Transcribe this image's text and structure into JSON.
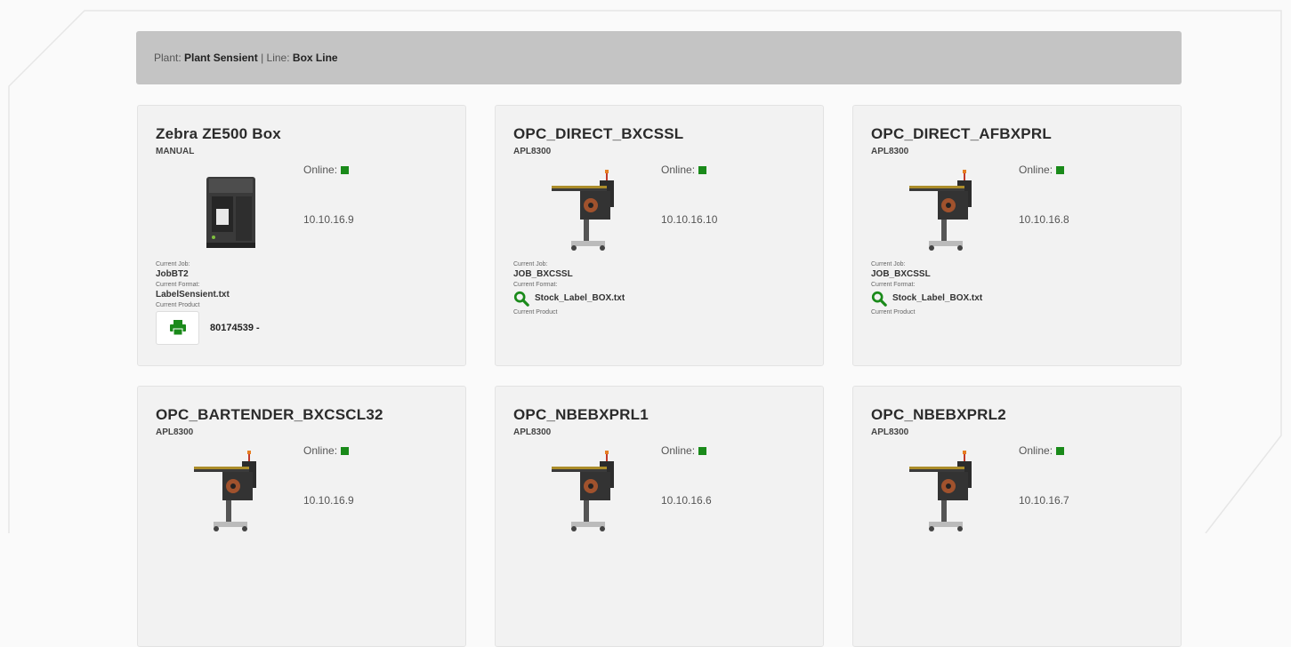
{
  "header": {
    "plant_label": "Plant:",
    "plant_value": "Plant Sensient",
    "separator": "|",
    "line_label": "Line:",
    "line_value": "Box Line"
  },
  "labels": {
    "online": "Online:",
    "current_job": "Current Job:",
    "current_format": "Current Format:",
    "current_product": "Current Product"
  },
  "status_color": "#1a8a1a",
  "devices": [
    {
      "name": "Zebra ZE500 Box",
      "model": "MANUAL",
      "ip": "10.10.16.9",
      "image": "zebra-printer-icon",
      "job": "JobBT2",
      "format": "LabelSensient.txt",
      "product": "80174539 -"
    },
    {
      "name": "OPC_DIRECT_BXCSSL",
      "model": "APL8300",
      "ip": "10.10.16.10",
      "image": "label-applicator-icon",
      "job": "JOB_BXCSSL",
      "format": "Stock_Label_BOX.txt"
    },
    {
      "name": "OPC_DIRECT_AFBXPRL",
      "model": "APL8300",
      "ip": "10.10.16.8",
      "image": "label-applicator-icon",
      "job": "JOB_BXCSSL",
      "format": "Stock_Label_BOX.txt"
    },
    {
      "name": "OPC_BARTENDER_BXCSCL32",
      "model": "APL8300",
      "ip": "10.10.16.9",
      "image": "label-applicator-icon"
    },
    {
      "name": "OPC_NBEBXPRL1",
      "model": "APL8300",
      "ip": "10.10.16.6",
      "image": "label-applicator-icon"
    },
    {
      "name": "OPC_NBEBXPRL2",
      "model": "APL8300",
      "ip": "10.10.16.7",
      "image": "label-applicator-icon"
    }
  ]
}
